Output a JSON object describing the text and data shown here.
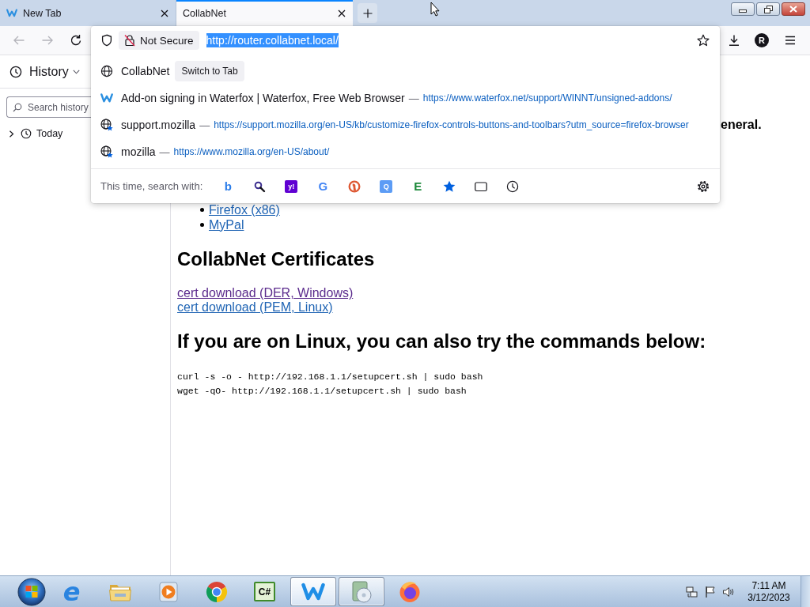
{
  "tabs": [
    {
      "title": "New Tab",
      "has_icon": true,
      "selected": false
    },
    {
      "title": "CollabNet",
      "has_icon": false,
      "selected": true
    }
  ],
  "navigation": [
    {
      "kind": "back",
      "disabled": true
    },
    {
      "kind": "forward",
      "disabled": true
    },
    {
      "kind": "reload",
      "disabled": false
    }
  ],
  "address_bar": {
    "security_label": "Not Secure",
    "url": "http://router.collabnet.local/",
    "url_selected": true,
    "bookmarked": false
  },
  "account": {
    "initial": "R"
  },
  "suggestions": [
    {
      "kind": "open-tab",
      "title": "CollabNet",
      "action": "Switch to Tab"
    },
    {
      "kind": "site",
      "title": "Add-on signing in Waterfox | Waterfox, Free Web Browser",
      "dash": "—",
      "url": "https://www.waterfox.net/support/WINNT/unsigned-addons/"
    },
    {
      "kind": "bookmark",
      "title": "support.mozilla",
      "dash": "—",
      "url": "https://support.mozilla.org/en-US/kb/customize-firefox-controls-buttons-and-toolbars?utm_source=firefox-browser"
    },
    {
      "kind": "bookmark",
      "title": "mozilla",
      "dash": "—",
      "url": "https://www.mozilla.org/en-US/about/"
    }
  ],
  "search_with": {
    "label": "This time, search with:",
    "engines": [
      {
        "kind": "letter",
        "glyph": "b",
        "color": "#2b7de9"
      },
      {
        "kind": "magnifier"
      },
      {
        "kind": "tile-letter",
        "glyph": "y!",
        "color": "#6001d2"
      },
      {
        "kind": "letter",
        "glyph": "G",
        "color": "#4285f4"
      },
      {
        "kind": "duck"
      },
      {
        "kind": "tile-letter",
        "glyph": "Q",
        "color": "#5c9cf5"
      },
      {
        "kind": "letter",
        "glyph": "E",
        "color": "#1e8a3c"
      },
      {
        "kind": "star"
      },
      {
        "kind": "tab"
      },
      {
        "kind": "clock"
      }
    ]
  },
  "sidebar": {
    "title": "History",
    "search_placeholder": "Search history",
    "groups": [
      {
        "label": "Today",
        "expanded": false
      }
    ]
  },
  "page": {
    "cut_text": "eneral.",
    "links": [
      {
        "text": "Firefox (x86)",
        "visited": false
      },
      {
        "text": "MyPal",
        "visited": false
      }
    ],
    "heading": "CollabNet Certificates",
    "cert_links": [
      {
        "text": "cert download (DER, Windows)",
        "visited": true
      },
      {
        "text": "cert download (PEM, Linux)",
        "visited": false
      }
    ],
    "linux_heading": "If you are on Linux, you can also try the commands below:",
    "commands": [
      "curl -s -o - http://192.168.1.1/setupcert.sh | sudo bash",
      "wget -qO- http://192.168.1.1/setupcert.sh | sudo bash"
    ]
  },
  "taskbar": {
    "apps": [
      {
        "kind": "letter",
        "glyph": "e",
        "color": "#2a84e0",
        "running": false,
        "selected": false
      },
      {
        "kind": "folder",
        "running": false,
        "selected": false
      },
      {
        "kind": "player",
        "running": false,
        "selected": false
      },
      {
        "kind": "ring",
        "running": false,
        "selected": false
      },
      {
        "kind": "tile-letter",
        "glyph": "C#",
        "color": "#e4f2d6",
        "running": false,
        "selected": false
      },
      {
        "kind": "wave",
        "running": true,
        "selected": true
      },
      {
        "kind": "disc",
        "running": true,
        "selected": false
      },
      {
        "kind": "flame",
        "running": false,
        "selected": false
      }
    ],
    "clock": {
      "time": "7:11 AM",
      "date": "3/12/2023"
    }
  }
}
